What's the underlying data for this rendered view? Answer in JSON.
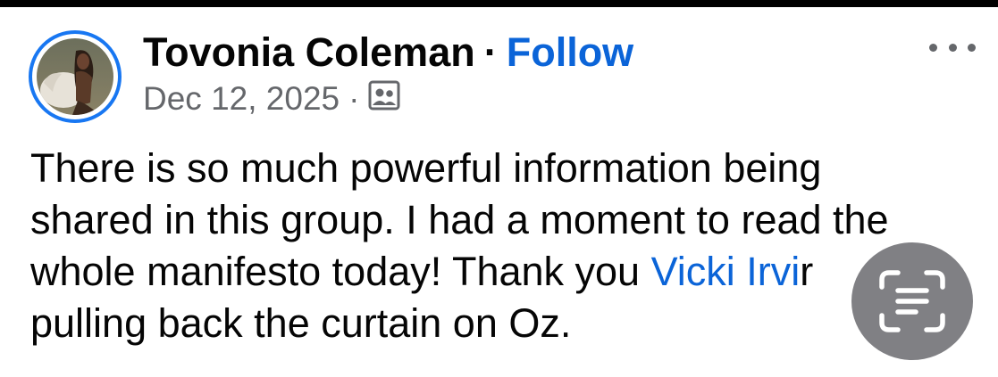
{
  "post": {
    "author_name": "Tovonia Coleman",
    "separator": "·",
    "follow_label": "Follow",
    "date": "Dec 12, 2025",
    "meta_separator": "·",
    "audience_icon": "group-audience-icon",
    "more_icon": "more-options-icon",
    "text": {
      "line1": "There is so much powerful information being",
      "line2": "shared in this group. I had a moment to read the",
      "line3_before": "whole manifesto today! Thank you ",
      "mention": "Vicki Irvi",
      "line3_after": "r",
      "line4": "pulling back the curtain on Oz."
    }
  },
  "overlay": {
    "scan_icon": "live-text-scan-icon"
  },
  "colors": {
    "link": "#0b64d8",
    "avatar_ring": "#1877f2",
    "meta_gray": "#65676b",
    "text": "#050505"
  }
}
